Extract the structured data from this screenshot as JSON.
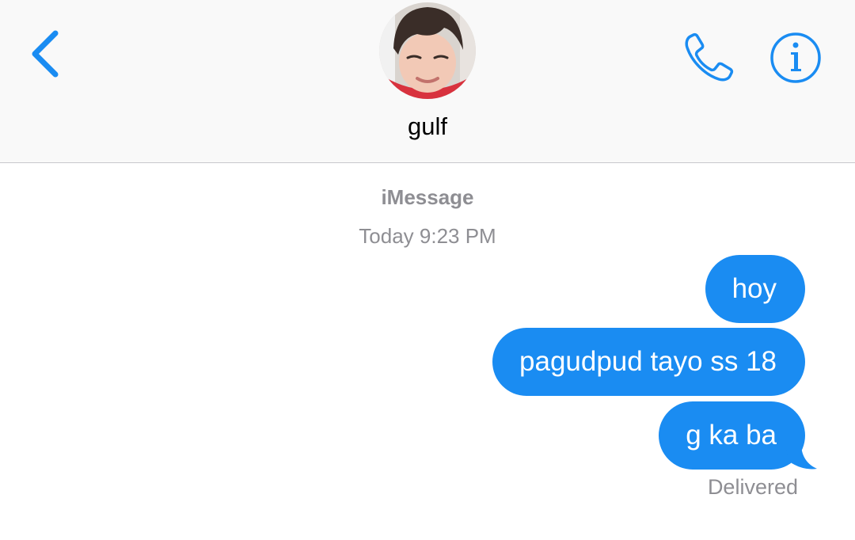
{
  "header": {
    "contact_name": "gulf",
    "back_icon": "chevron-left-icon",
    "call_icon": "phone-icon",
    "info_icon": "info-icon"
  },
  "conversation": {
    "service": "iMessage",
    "timestamp": "Today 9:23 PM",
    "messages": [
      {
        "text": "hoy",
        "sender": "me"
      },
      {
        "text": "pagudpud tayo ss 18",
        "sender": "me"
      },
      {
        "text": "g ka ba",
        "sender": "me"
      }
    ],
    "status": "Delivered"
  },
  "colors": {
    "accent": "#1a8cf2",
    "header_bg": "#f9f9f9",
    "meta_text": "#8e8e93"
  }
}
